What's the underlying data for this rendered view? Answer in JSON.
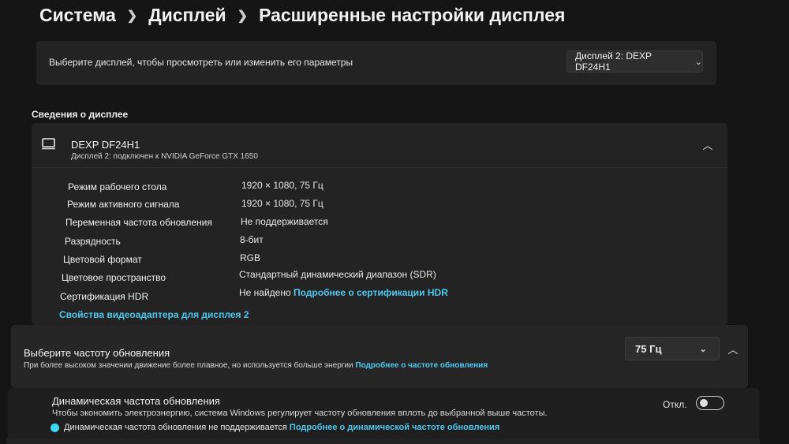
{
  "breadcrumb": [
    "Система",
    "Дисплей",
    "Расширенные настройки дисплея"
  ],
  "select_display": {
    "text": "Выберите дисплей, чтобы просмотреть или изменить его параметры",
    "dropdown_value": "Дисплей 2: DEXP DF24H1"
  },
  "display_info": {
    "section_title": "Сведения о дисплее",
    "name": "DEXP DF24H1",
    "subtitle": "Дисплей 2: подключен к NVIDIA GeForce GTX 1650",
    "properties": [
      {
        "label": "Режим рабочего стола",
        "value": "1920 × 1080, 75 Гц"
      },
      {
        "label": "Режим активного сигнала",
        "value": "1920 × 1080, 75 Гц"
      },
      {
        "label": "Переменная частота обновления",
        "value": "Не поддерживается"
      },
      {
        "label": "Разрядность",
        "value": "8-бит"
      },
      {
        "label": "Цветовой формат",
        "value": "RGB"
      },
      {
        "label": "Цветовое пространство",
        "value": "Стандартный динамический диапазон (SDR)"
      },
      {
        "label": "Сертификация HDR",
        "value": "Не найдено",
        "link": "Подробнее о сертификации HDR"
      }
    ],
    "adapter_link": "Свойства видеоадаптера для дисплея 2"
  },
  "refresh_rate": {
    "title": "Выберите частоту обновления",
    "subtitle": "При более высоком значении движение более плавное, но используется больше энергии",
    "link": "Подробнее о частоте обновления",
    "value": "75 Гц"
  },
  "dynamic_refresh": {
    "title": "Динамическая частота обновления",
    "subtitle": "Чтобы экономить электроэнергию, система Windows регулирует частоту обновления вплоть до выбранной выше частоты.",
    "note": "Динамическая частота обновления не поддерживается",
    "link": "Подробнее о динамической частоте обновления",
    "toggle_label": "Откл.",
    "enabled": false
  },
  "colors": {
    "accent_link": "#4fc8ef",
    "background": "#151515",
    "card": "#232323"
  },
  "icons": [
    "chevron-right-icon",
    "chevron-down-icon",
    "chevron-up-icon",
    "monitor-icon",
    "status-dot-icon"
  ]
}
